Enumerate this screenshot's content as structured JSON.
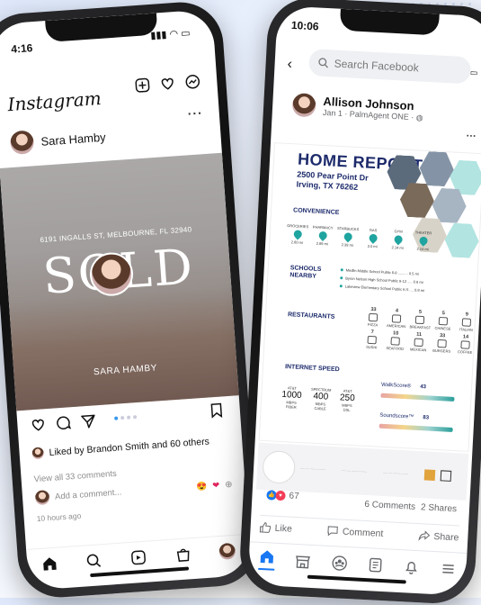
{
  "instagram": {
    "status_time": "4:16",
    "logo": "Instagram",
    "top_icons": [
      "plus-square-icon",
      "heart-icon",
      "messenger-icon"
    ],
    "post": {
      "author": "Sara Hamby",
      "image": {
        "address": "6191 INGALLS ST, MELBOURNE, FL 32940",
        "headline": "SOLD",
        "agent": "SARA HAMBY"
      },
      "liked_by": "Liked by Brandon Smith and 60 others",
      "view_comments": "View all 33 comments",
      "add_comment_placeholder": "Add a comment...",
      "time": "10 hours ago"
    },
    "bottom_nav": [
      "home-icon",
      "search-icon",
      "reels-icon",
      "shop-icon",
      "profile-icon"
    ]
  },
  "facebook": {
    "status_time": "10:06",
    "search_placeholder": "Search Facebook",
    "post": {
      "author": "Allison Johnson",
      "meta": "Jan 1 · PalmAgent ONE · ",
      "report": {
        "title": "HOME REPORT",
        "address_line1": "2500 Pear Point Dr",
        "address_line2": "Irving, TX 76262",
        "convenience": {
          "title": "CONVENIENCE",
          "items": [
            {
              "label": "GROCERIES",
              "dist": "2.60 mi"
            },
            {
              "label": "PHARMACY",
              "dist": "2.89 mi"
            },
            {
              "label": "STARBUCKS",
              "dist": "2.39 mi"
            },
            {
              "label": "GAS",
              "dist": "3.0 mi"
            },
            {
              "label": "GYM",
              "dist": "2.14 mi"
            },
            {
              "label": "THEATER",
              "dist": "2.14 mi"
            }
          ]
        },
        "schools": {
          "title_line1": "SCHOOLS",
          "title_line2": "NEARBY",
          "items": [
            "Medlin Middle School Public 6-8 .......... 0.5 mi",
            "Byron Nelson High School Public 9-12 ..... 0.6 mi",
            "Lakeview Elementary School Public K-5 .... 0.8 mi"
          ]
        },
        "restaurants": {
          "title": "RESTAURANTS",
          "counts": [
            {
              "n": "33",
              "label": "PIZZA"
            },
            {
              "n": "4",
              "label": "AMERICAN"
            },
            {
              "n": "5",
              "label": "BREAKFAST"
            },
            {
              "n": "5",
              "label": "CHINESE"
            },
            {
              "n": "9",
              "label": "ITALIAN"
            },
            {
              "n": "7",
              "label": "SUSHI"
            },
            {
              "n": "10",
              "label": "SEAFOOD"
            },
            {
              "n": "11",
              "label": "MEXICAN"
            },
            {
              "n": "33",
              "label": "BURGERS"
            },
            {
              "n": "14",
              "label": "COFFEE"
            }
          ]
        },
        "internet": {
          "title": "INTERNET SPEED",
          "providers": [
            {
              "name": "AT&T",
              "speed": "1000",
              "unit": "MBPS",
              "type": "FIBER"
            },
            {
              "name": "SPECTRUM",
              "speed": "400",
              "unit": "MBPS",
              "type": "CABLE"
            },
            {
              "name": "AT&T",
              "speed": "250",
              "unit": "MBPS",
              "type": "DSL"
            }
          ]
        },
        "walk_score": {
          "label": "WalkScore®",
          "value": "43"
        },
        "sound_score": {
          "label": "Soundscore™",
          "value": "83"
        }
      },
      "reaction_count": "67",
      "comments": "6 Comments",
      "shares": "2 Shares",
      "actions": [
        "Like",
        "Comment",
        "Share"
      ]
    },
    "bottom_nav": [
      "home-icon",
      "marketplace-icon",
      "groups-icon",
      "news-icon",
      "bell-icon",
      "menu-icon"
    ]
  },
  "colors": {
    "navy": "#1d2b6b",
    "teal": "#1fa4a0",
    "fb_blue": "#1877f2",
    "ig_blue": "#3897f0"
  }
}
